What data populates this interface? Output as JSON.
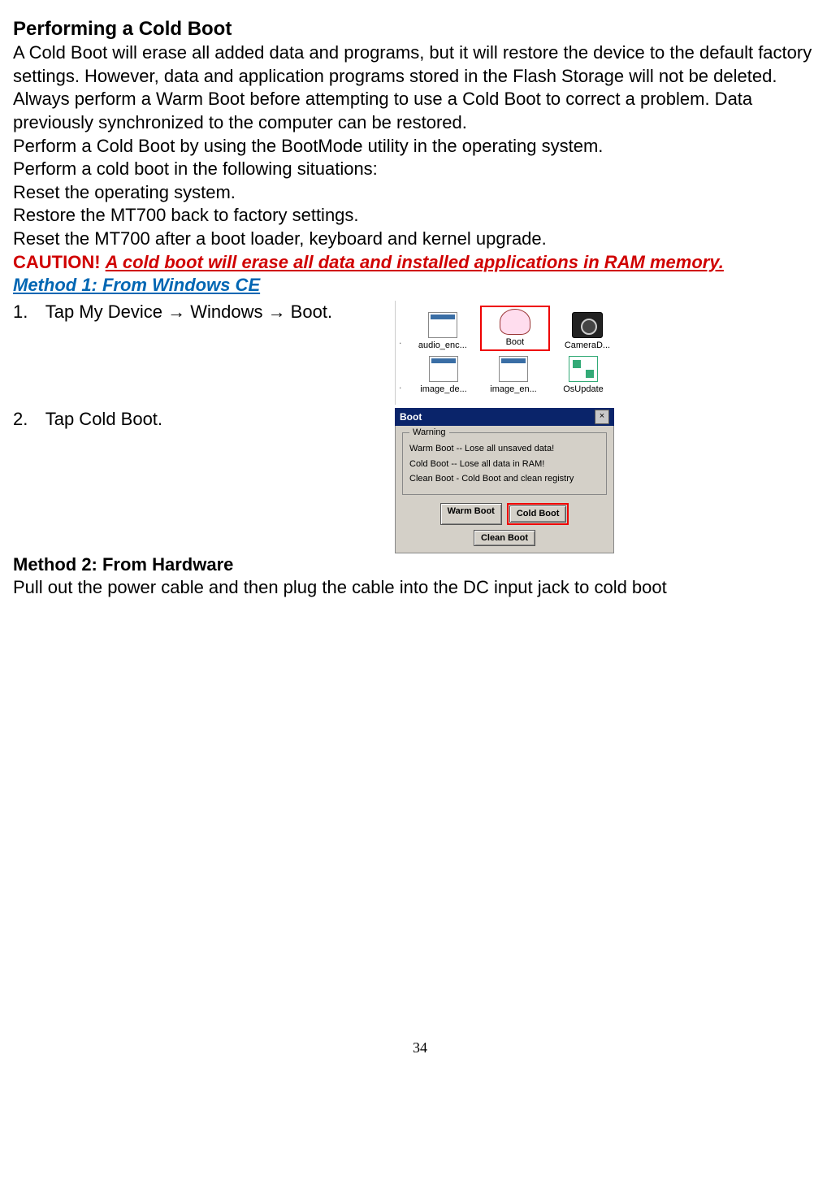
{
  "title": "Performing a Cold Boot",
  "intro": "A Cold Boot will erase all added data and programs, but it will restore the device to the default factory settings. However, data and application programs stored in the Flash Storage will not be deleted.",
  "advice": "Always perform a Warm Boot before attempting to use a Cold Boot to correct a problem. Data previously synchronized to the computer can be restored.",
  "how": "Perform a Cold Boot by using the BootMode utility in the operating system.",
  "when_intro": "Perform a cold boot in the following situations:",
  "situations": [
    "Reset the operating system.",
    "Restore the MT700 back to factory settings.",
    "Reset the MT700 after a boot loader, keyboard and kernel upgrade."
  ],
  "caution_label": "CAUTION!",
  "caution_text": "A cold boot will erase all data and installed applications in RAM memory.",
  "method1_title": "Method 1: From Windows CE",
  "step1": "Tap My Device  →  Windows  →  Boot.",
  "step2": "Tap Cold Boot.",
  "method2_title": "Method 2: From Hardware",
  "method2_text": "Pull out the power cable and then plug the cable into the DC input jack to cold boot",
  "fig1": {
    "icons_row1": [
      "audio_enc...",
      "Boot",
      "CameraD..."
    ],
    "icons_row2": [
      "image_de...",
      "image_en...",
      "OsUpdate"
    ]
  },
  "fig2": {
    "title": "Boot",
    "legend": "Warning",
    "lines": [
      "Warm Boot -- Lose all unsaved data!",
      "Cold Boot -- Lose all data in RAM!",
      "Clean Boot - Cold Boot and clean registry"
    ],
    "btn_warm": "Warm Boot",
    "btn_cold": "Cold Boot",
    "btn_clean": "Clean Boot"
  },
  "page_number": "34"
}
